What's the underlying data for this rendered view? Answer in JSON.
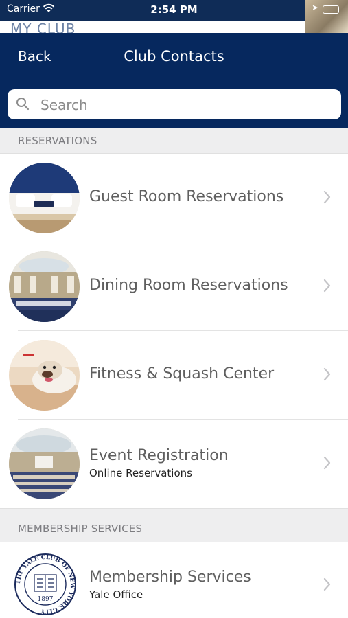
{
  "status_bar": {
    "carrier": "Carrier",
    "time": "2:54 PM"
  },
  "background_title": "MY CLUB",
  "nav": {
    "back_label": "Back",
    "title": "Club Contacts"
  },
  "search": {
    "placeholder": "Search"
  },
  "sections": [
    {
      "header": "RESERVATIONS",
      "items": [
        {
          "title": "Guest Room Reservations",
          "subtitle": "",
          "image": "guest-room-photo"
        },
        {
          "title": "Dining Room Reservations",
          "subtitle": "",
          "image": "dining-room-photo"
        },
        {
          "title": "Fitness & Squash Center",
          "subtitle": "",
          "image": "bulldog-squash-photo"
        },
        {
          "title": "Event Registration",
          "subtitle": "Online Reservations",
          "image": "event-hall-photo"
        }
      ]
    },
    {
      "header": "MEMBERSHIP SERVICES",
      "items": [
        {
          "title": "Membership Services",
          "subtitle": "Yale Office",
          "image": "yale-club-seal"
        }
      ]
    }
  ],
  "seal": {
    "ring_text": "THE YALE CLUB OF NEW YORK CITY",
    "year": "1897"
  },
  "colors": {
    "nav_background": "#06285e",
    "section_background": "#eeeeef",
    "row_text": "#5f5f5f"
  }
}
